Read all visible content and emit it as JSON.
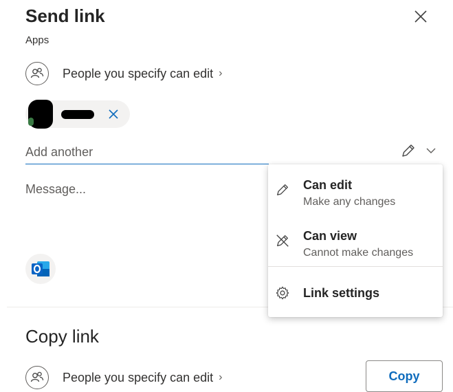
{
  "header": {
    "title": "Send link",
    "subtitle": "Apps"
  },
  "permission": {
    "label": "People you specify can edit",
    "chevron": "›"
  },
  "recipient": {
    "chip_remove_icon": "close-icon"
  },
  "add_input": {
    "placeholder": "Add another"
  },
  "message": {
    "placeholder": "Message..."
  },
  "copy_section": {
    "title": "Copy link",
    "permission_label": "People you specify can edit",
    "chevron": "›",
    "copy_label": "Copy"
  },
  "dropdown": {
    "items": [
      {
        "title": "Can edit",
        "subtitle": "Make any changes",
        "icon": "pencil-icon"
      },
      {
        "title": "Can view",
        "subtitle": "Cannot make changes",
        "icon": "no-edit-icon"
      },
      {
        "title": "Link settings",
        "icon": "gear-icon"
      }
    ]
  },
  "colors": {
    "accent": "#0f6cbd",
    "outlook_blue": "#0a64c5",
    "text": "#242424",
    "muted": "#605e5c"
  }
}
